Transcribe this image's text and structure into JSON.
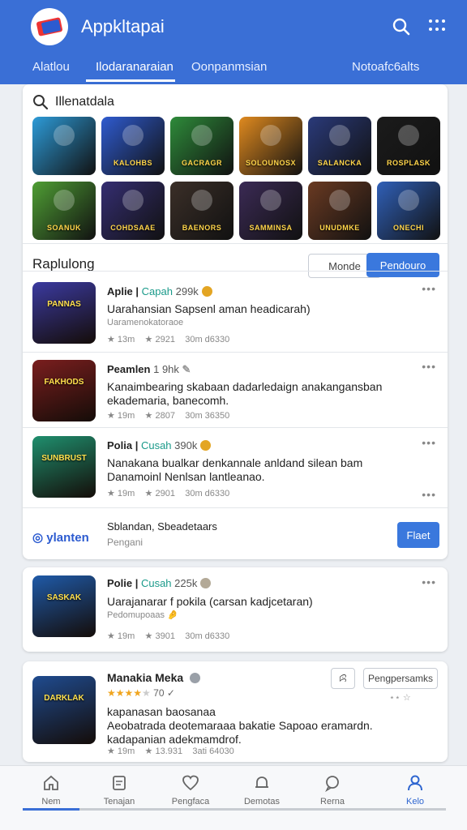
{
  "app": {
    "title": "Appkltapai"
  },
  "tabs": [
    "Alatlou",
    "Ilodaranaraian",
    "Oonpanmsian",
    "Notoafc6alts"
  ],
  "search": {
    "label": "Illenatdala"
  },
  "grid_tiles": [
    {
      "caption": "",
      "color": "#2d9bd8"
    },
    {
      "caption": "KALOHBS",
      "color": "#2f5bd0"
    },
    {
      "caption": "GACRAGR",
      "color": "#2e8b3a"
    },
    {
      "caption": "SOLOUNOSX",
      "color": "#e08a1f"
    },
    {
      "caption": "SALANCKA",
      "color": "#2a3a7a"
    },
    {
      "caption": "ROSPLASK",
      "color": "#1b1b1b"
    },
    {
      "caption": "SOANUK",
      "color": "#4f9e34"
    },
    {
      "caption": "COHDSAAE",
      "color": "#352e72"
    },
    {
      "caption": "BAENORS",
      "color": "#3b2f28"
    },
    {
      "caption": "SAMMINSA",
      "color": "#3b2a55"
    },
    {
      "caption": "UNUDMKE",
      "color": "#6a3a22"
    },
    {
      "caption": "ONECHI",
      "color": "#3060b8"
    }
  ],
  "section": {
    "title": "Raplulong",
    "btn_secondary": "Monde",
    "btn_primary": "Pendouro"
  },
  "items": [
    {
      "name": "Aplie",
      "tag": "Capah",
      "count": "299k",
      "desc": "Uarahansian Sapsenl aman headicarah)",
      "desc2": "Uaramenokatoraoe",
      "m1": "13m",
      "m2": "2921",
      "m3": "30m d6330",
      "thumb_caption": "PANNAS",
      "thumb_color": "#3b3aa0"
    },
    {
      "name": "Peamlen",
      "tag": "",
      "count": "1 9hk",
      "desc": "Kanaimbearing skabaan dadarledaign anakangansban",
      "desc2": "ekademaria, banecomh.",
      "m1": "19m",
      "m2": "2807",
      "m3": "30m 36350",
      "thumb_caption": "FAKHODS",
      "thumb_color": "#7a1e1e"
    },
    {
      "name": "Polia",
      "tag": "Cusah",
      "count": "390k",
      "desc": "Nanakana bualkar denkannale anldand silean bam",
      "desc2": "Danamoinl Nenlsan lantleanao.",
      "m1": "19m",
      "m2": "2901",
      "m3": "30m d6330",
      "thumb_caption": "SUNBRUST",
      "thumb_color": "#1f8f6e"
    }
  ],
  "promo": {
    "brand": "ylanten",
    "title": "Sblandan, Sbeadetaars",
    "subtitle": "Pengani",
    "button": "Flaet"
  },
  "item4": {
    "name": "Polie",
    "tag": "Cusah",
    "count": "225k",
    "desc": "Uarajanarar f pokila (carsan kadjcetaran)",
    "desc2": "Pedomupoaas",
    "m1": "19m",
    "m2": "3901",
    "m3": "30m d6330",
    "thumb_caption": "SASKAK",
    "thumb_color": "#1f5aa8"
  },
  "item5": {
    "name": "Manakia Meka",
    "rating_text": "70",
    "desc": "kapanasan baosanaa",
    "desc2": "Aeobatrada deotemaraaa bakatie Sapoao eramardn.",
    "desc3": "kadapanian adekmamdrof.",
    "m1": "19m",
    "m2": "13.931",
    "m3": "3ati 64030",
    "btn_small": "ꕸ",
    "btn": "Pengpersamks",
    "thumb_caption": "DARKLAK",
    "thumb_color": "#1f4b8f",
    "rating": 4
  },
  "bottom_nav": [
    "Nem",
    "Tenajan",
    "Pengfaca",
    "Demotas",
    "Rerna",
    "Kelo"
  ],
  "colors": {
    "primary": "#3a6fd6",
    "accent": "#3a78dd"
  }
}
